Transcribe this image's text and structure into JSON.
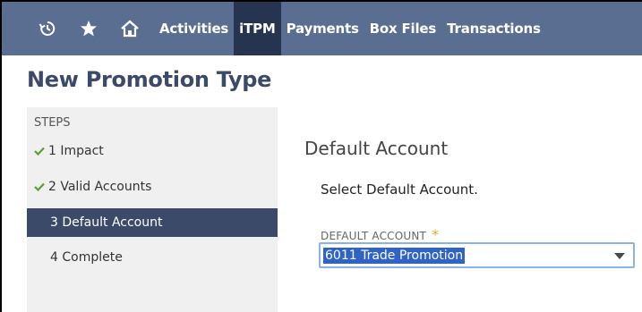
{
  "nav": {
    "icons": [
      "recent-icon",
      "star-icon",
      "home-icon"
    ],
    "items": [
      {
        "label": "Activities"
      },
      {
        "label": "iTPM"
      },
      {
        "label": "Payments"
      },
      {
        "label": "Box Files"
      },
      {
        "label": "Transactions"
      }
    ],
    "active_item": "iTPM"
  },
  "page": {
    "title": "New Promotion Type"
  },
  "steps": {
    "label": "STEPS",
    "items": [
      {
        "label": "1 Impact",
        "completed": true
      },
      {
        "label": "2 Valid Accounts",
        "completed": true
      },
      {
        "label": "3 Default Account",
        "completed": false,
        "active": true
      },
      {
        "label": "4 Complete",
        "completed": false
      }
    ]
  },
  "main": {
    "section_title": "Default Account",
    "description": "Select Default Account.",
    "field": {
      "label": "DEFAULT ACCOUNT",
      "required_marker": "*",
      "value": "6011 Trade Promotion"
    }
  },
  "colors": {
    "nav_bg": "#5a6e92",
    "nav_active": "#26344f",
    "title": "#3b4a68",
    "check": "#5aa02c",
    "required": "#e7a72c",
    "selection": "#2f63c7"
  }
}
